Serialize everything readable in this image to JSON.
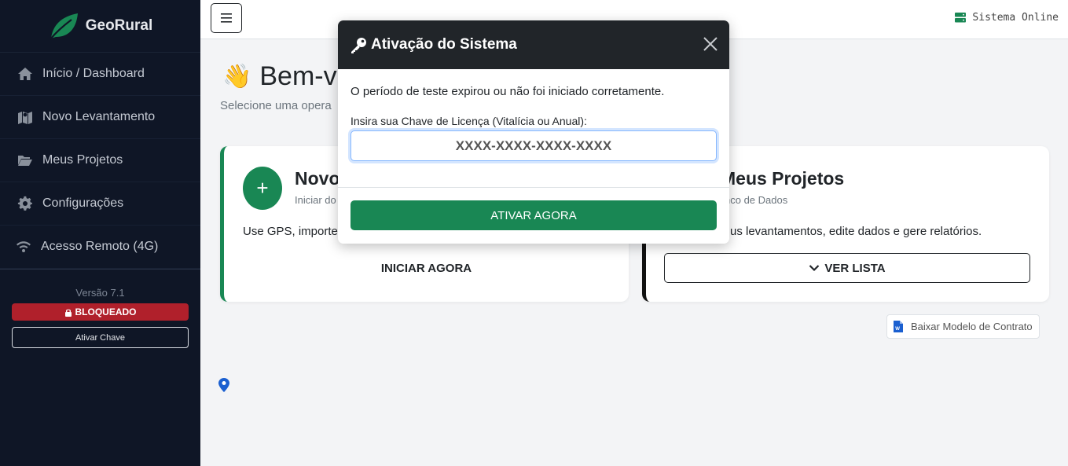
{
  "sidebar": {
    "brand": "GeoRural",
    "items": [
      {
        "label": "Início / Dashboard",
        "icon": "home-icon"
      },
      {
        "label": "Novo Levantamento",
        "icon": "map-icon"
      },
      {
        "label": "Meus Projetos",
        "icon": "folder-open-icon"
      },
      {
        "label": "Configurações",
        "icon": "gear-icon"
      },
      {
        "label": "Acesso Remoto (4G)",
        "icon": "wifi-icon"
      }
    ],
    "version": "Versão 7.1",
    "locked_badge": "BLOQUEADO",
    "activate_key_label": "Ativar Chave"
  },
  "topbar": {
    "status": "Sistema Online"
  },
  "main": {
    "welcome_emoji": "👋",
    "welcome": "Bem-vi",
    "subtitle": "Selecione uma opera",
    "card_new": {
      "title": "Novo",
      "subtitle": "Iniciar do",
      "description": "Use GPS, importe",
      "button": "INICIAR AGORA"
    },
    "card_projects": {
      "title": "Meus Projetos",
      "subtitle": "nco de Dados",
      "description": "us levantamentos, edite dados e gere relatórios.",
      "button": "VER LISTA"
    },
    "download_contract": "Baixar Modelo de Contrato"
  },
  "modal": {
    "title": "Ativação do Sistema",
    "message": "O período de teste expirou ou não foi iniciado corretamente.",
    "label": "Insira sua Chave de Licença (Vitalícia ou Anual):",
    "placeholder": "XXXX-XXXX-XXXX-XXXX",
    "value": "",
    "button": "ATIVAR AGORA"
  },
  "colors": {
    "sidebar_bg": "#0f1626",
    "accent_green": "#198754",
    "danger": "#b0202b",
    "modal_header": "#212529"
  }
}
